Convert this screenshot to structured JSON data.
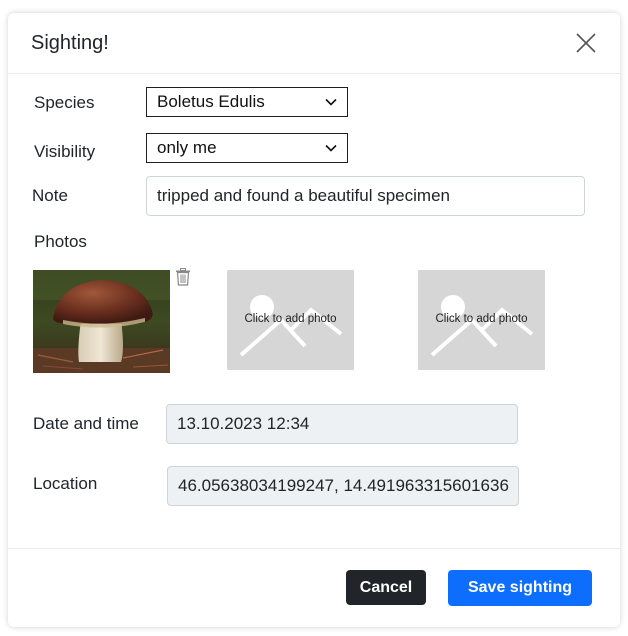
{
  "dialog": {
    "title": "Sighting!"
  },
  "form": {
    "species": {
      "label": "Species",
      "value": "Boletus Edulis"
    },
    "visibility": {
      "label": "Visibility",
      "value": "only me"
    },
    "note": {
      "label": "Note",
      "value": "tripped and found a beautiful specimen"
    },
    "photos": {
      "label": "Photos",
      "add_photo_caption": "Click to add photo"
    },
    "datetime": {
      "label": "Date and time",
      "value": "13.10.2023 12:34"
    },
    "location": {
      "label": "Location",
      "value": "46.05638034199247, 14.491963315601636"
    }
  },
  "footer": {
    "cancel_label": "Cancel",
    "save_label": "Save sighting"
  },
  "colors": {
    "primary": "#0d6efd",
    "dark": "#212529",
    "placeholder_bg": "#d6d6d6",
    "readonly_bg": "#eef1f4"
  },
  "icons": [
    "close-icon",
    "chevron-down-icon",
    "trash-icon",
    "image-placeholder-icon"
  ]
}
